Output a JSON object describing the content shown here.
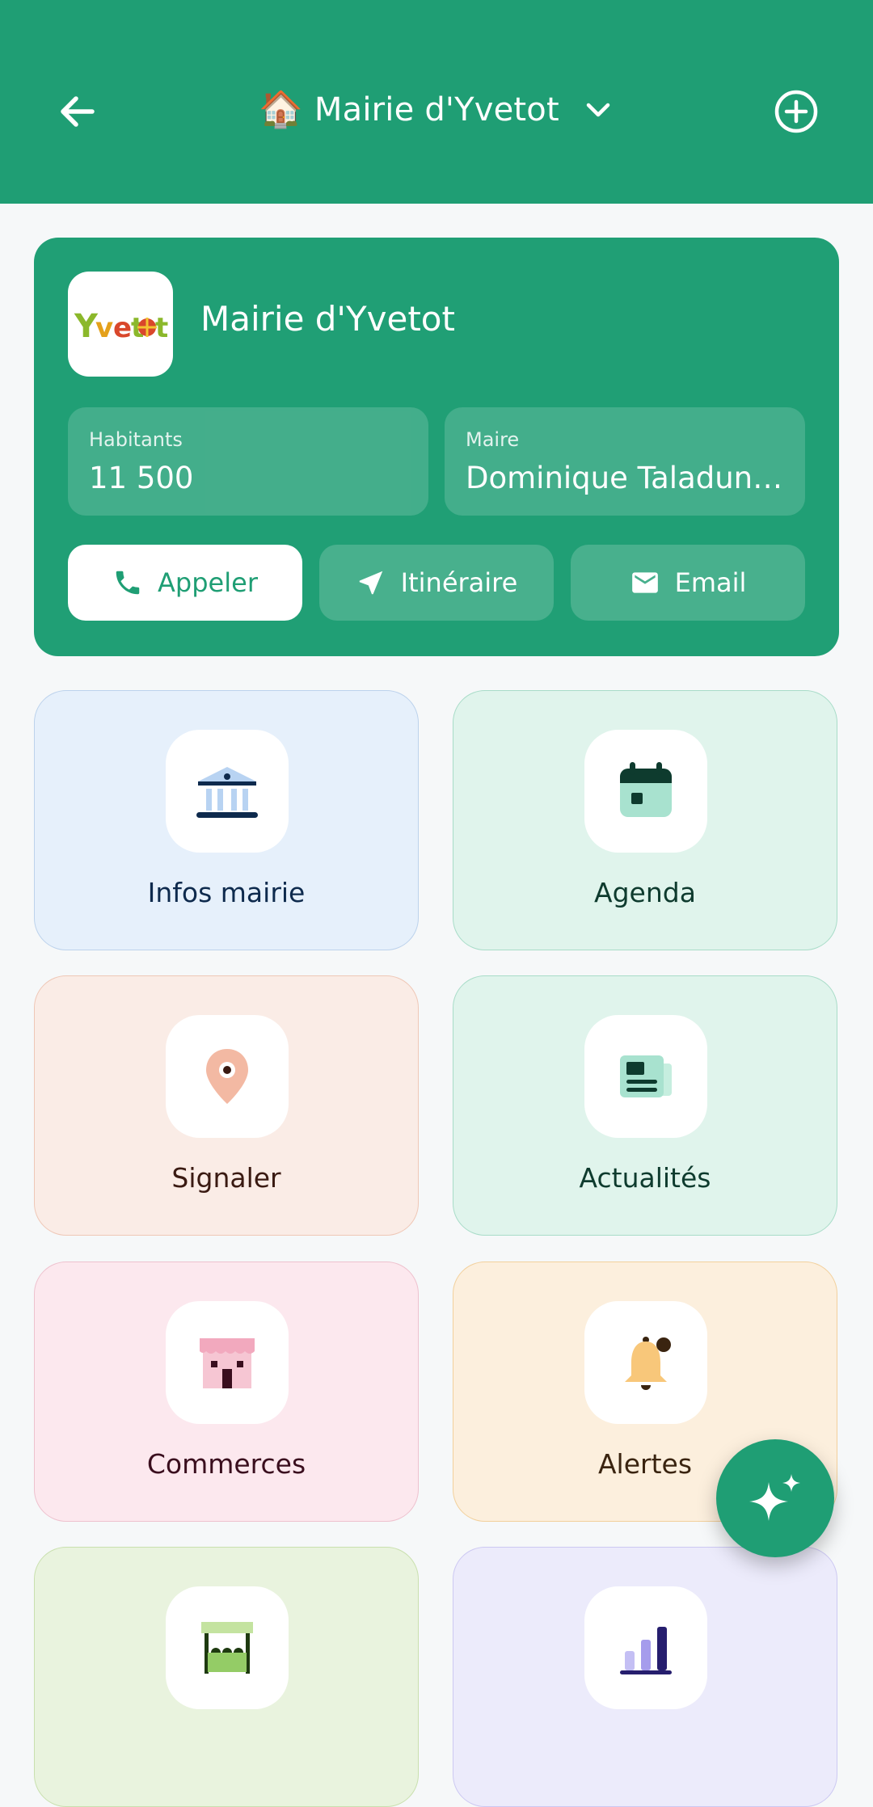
{
  "app_bar": {
    "title": "Mairie d'Yvetot",
    "house_emoji": "🏠",
    "back_icon": "arrow-left-icon",
    "dropdown_icon": "chevron-down-icon",
    "add_icon": "plus-circle-icon"
  },
  "header_card": {
    "logo_text": "Yvetot",
    "name": "Mairie d'Yvetot",
    "stats": [
      {
        "label": "Habitants",
        "value": "11 500"
      },
      {
        "label": "Maire",
        "value": "Dominique Taladun C..."
      }
    ],
    "actions": [
      {
        "label": "Appeler",
        "icon": "phone-icon"
      },
      {
        "label": "Itinéraire",
        "icon": "navigation-icon"
      },
      {
        "label": "Email",
        "icon": "mail-icon"
      }
    ]
  },
  "tiles": [
    {
      "label": "Infos mairie",
      "icon": "town-hall-icon"
    },
    {
      "label": "Agenda",
      "icon": "calendar-icon"
    },
    {
      "label": "Signaler",
      "icon": "map-pin-icon"
    },
    {
      "label": "Actualités",
      "icon": "newspaper-icon"
    },
    {
      "label": "Commerces",
      "icon": "shop-icon"
    },
    {
      "label": "Alertes",
      "icon": "bell-icon"
    },
    {
      "label": "",
      "icon": "market-stall-icon"
    },
    {
      "label": "",
      "icon": "bar-chart-icon"
    }
  ],
  "fab": {
    "icon": "sparkles-icon"
  },
  "colors": {
    "primary": "#1F9E74",
    "background": "#F6F8F9"
  }
}
